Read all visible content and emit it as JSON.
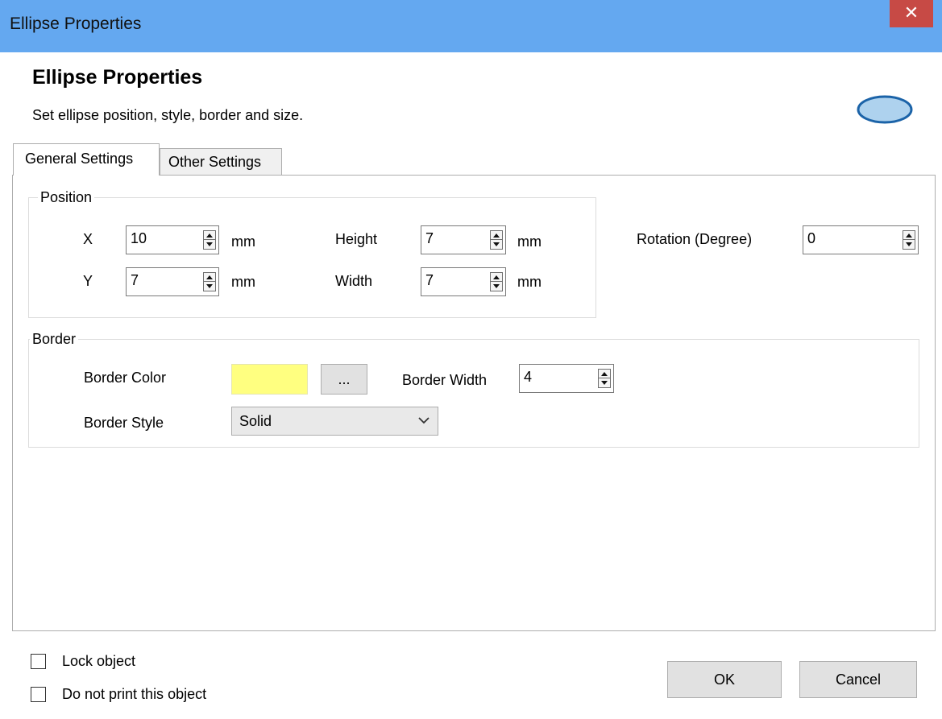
{
  "window": {
    "title": "Ellipse Properties",
    "close_glyph": "✕"
  },
  "header": {
    "title": "Ellipse Properties",
    "subtitle": "Set ellipse position, style, border and size.",
    "icon": "ellipse-icon"
  },
  "tabs": {
    "general": "General Settings",
    "other": "Other Settings"
  },
  "position": {
    "label": "Position",
    "x_label": "X",
    "x_value": "10",
    "y_label": "Y",
    "y_value": "7",
    "height_label": "Height",
    "height_value": "7",
    "width_label": "Width",
    "width_value": "7",
    "unit": "mm"
  },
  "rotation": {
    "label": "Rotation (Degree)",
    "value": "0"
  },
  "border": {
    "label": "Border",
    "color_label": "Border Color",
    "color_value": "#ffff80",
    "browse_label": "...",
    "width_label": "Border Width",
    "width_value": "4",
    "style_label": "Border Style",
    "style_value": "Solid"
  },
  "footer": {
    "lock_label": "Lock object",
    "noprint_label": "Do not print this object",
    "ok_label": "OK",
    "cancel_label": "Cancel"
  },
  "colors": {
    "titlebar": "#64a8f0",
    "close": "#c74a45",
    "accent_ellipse": "#aed2ee"
  }
}
